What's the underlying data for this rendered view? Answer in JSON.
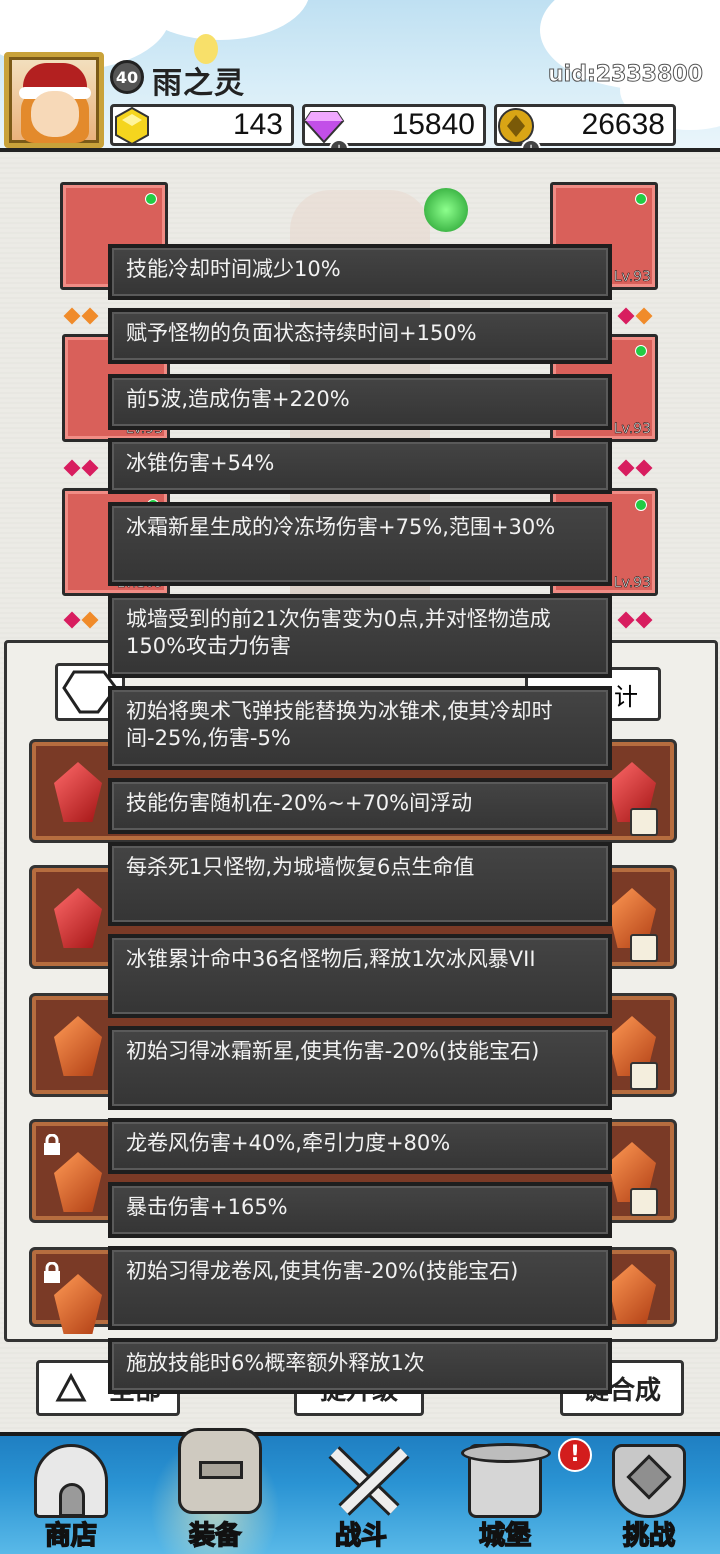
{
  "player": {
    "level": "40",
    "name": "雨之灵",
    "uid": "uid:2333800"
  },
  "resources": [
    {
      "name": "gold-gem",
      "value": "143",
      "color": "#f5d51e",
      "has_plus": false
    },
    {
      "name": "diamond",
      "value": "15840",
      "color": "#c24fe8",
      "has_plus": true
    },
    {
      "name": "coin",
      "value": "26638",
      "color": "#d9a515",
      "has_plus": true
    }
  ],
  "equipment_slots": [
    {
      "side": "left",
      "level": ""
    },
    {
      "side": "left",
      "level": "Lv.93"
    },
    {
      "side": "left",
      "level": "Lv.109"
    },
    {
      "side": "right",
      "level": "Lv.93"
    },
    {
      "side": "right",
      "level": "Lv.93"
    },
    {
      "side": "right",
      "level": "Lv.93"
    }
  ],
  "panel": {
    "tab_right_label": "计"
  },
  "bottom_buttons": {
    "all": "全部",
    "upgrade": "提升级",
    "merge": "键合成"
  },
  "tooltips": [
    "技能冷却时间减少10%",
    "赋予怪物的负面状态持续时间+150%",
    "前5波,造成伤害+220%",
    "冰锥伤害+54%",
    "冰霜新星生成的冷冻场伤害+75%,范围+30%",
    "城墙受到的前21次伤害变为0点,并对怪物造成150%攻击力伤害",
    "初始将奥术飞弹技能替换为冰锥术,使其冷却时间-25%,伤害-5%",
    "技能伤害随机在-20%~+70%间浮动",
    "每杀死1只怪物,为城墙恢复6点生命值",
    "冰锥累计命中36名怪物后,释放1次冰风暴VII",
    "初始习得冰霜新星,使其伤害-20%(技能宝石)",
    "龙卷风伤害+40%,牵引力度+80%",
    "暴击伤害+165%",
    "初始习得龙卷风,使其伤害-20%(技能宝石)",
    "施放技能时6%概率额外释放1次"
  ],
  "nav": [
    {
      "label": "商店",
      "icon": "shop-icon",
      "alert": false
    },
    {
      "label": "装备",
      "icon": "backpack-icon",
      "alert": false
    },
    {
      "label": "战斗",
      "icon": "crossed-swords-icon",
      "alert": false
    },
    {
      "label": "城堡",
      "icon": "castle-icon",
      "alert": true
    },
    {
      "label": "挑战",
      "icon": "shield-icon",
      "alert": false
    }
  ],
  "alert_mark": "!"
}
